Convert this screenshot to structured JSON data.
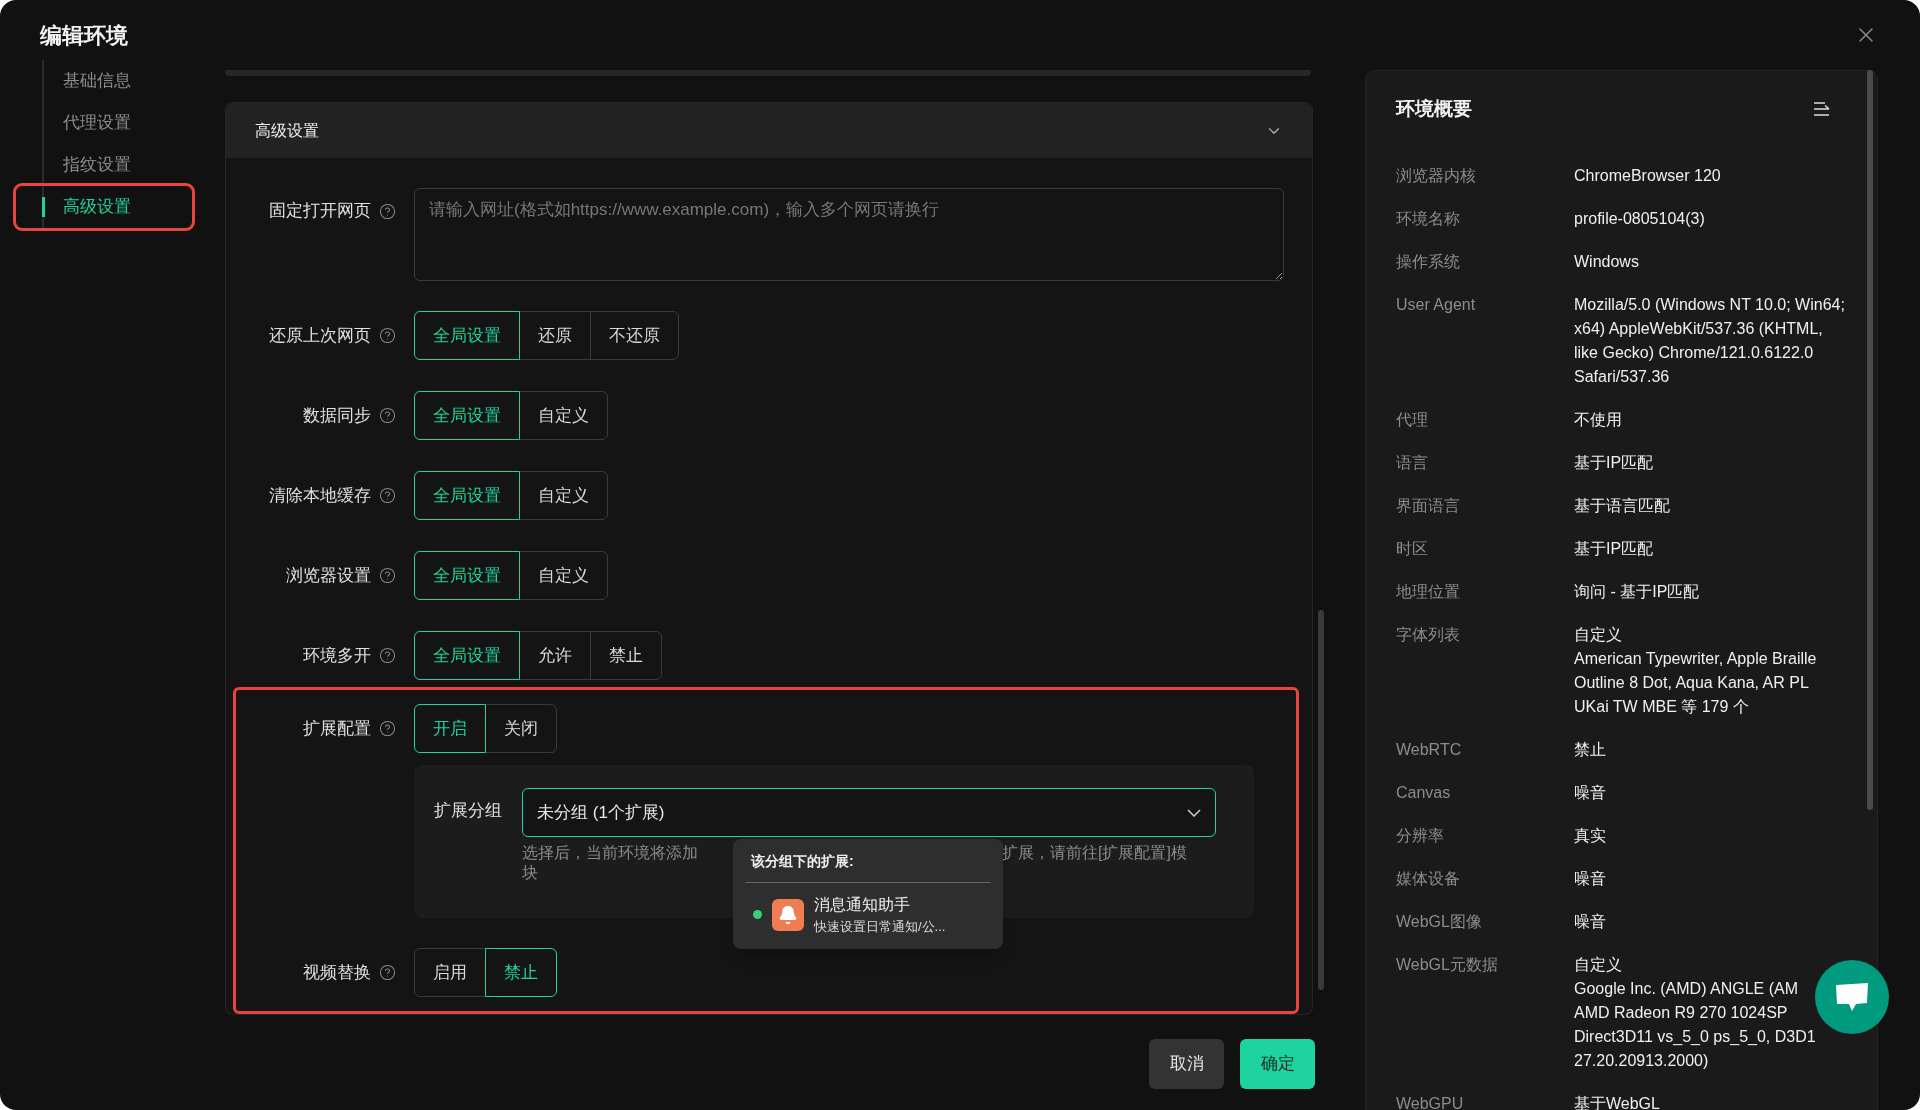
{
  "dialog": {
    "title": "编辑环境"
  },
  "nav": [
    {
      "label": "基础信息",
      "selected": false,
      "highlighted": false
    },
    {
      "label": "代理设置",
      "selected": false,
      "highlighted": false
    },
    {
      "label": "指纹设置",
      "selected": false,
      "highlighted": false
    },
    {
      "label": "高级设置",
      "selected": true,
      "highlighted": true
    }
  ],
  "section": {
    "title": "高级设置",
    "expanded": true
  },
  "url_field": {
    "label": "固定打开网页",
    "placeholder": "请输入网址(格式如https://www.example.com)，输入多个网页请换行"
  },
  "rows": [
    {
      "label": "还原上次网页",
      "options": [
        {
          "label": "全局设置",
          "selected": true
        },
        {
          "label": "还原",
          "selected": false
        },
        {
          "label": "不还原",
          "selected": false
        }
      ]
    },
    {
      "label": "数据同步",
      "options": [
        {
          "label": "全局设置",
          "selected": true
        },
        {
          "label": "自定义",
          "selected": false
        }
      ]
    },
    {
      "label": "清除本地缓存",
      "options": [
        {
          "label": "全局设置",
          "selected": true
        },
        {
          "label": "自定义",
          "selected": false
        }
      ]
    },
    {
      "label": "浏览器设置",
      "options": [
        {
          "label": "全局设置",
          "selected": true
        },
        {
          "label": "自定义",
          "selected": false
        }
      ]
    },
    {
      "label": "环境多开",
      "options": [
        {
          "label": "全局设置",
          "selected": true
        },
        {
          "label": "允许",
          "selected": false
        },
        {
          "label": "禁止",
          "selected": false
        }
      ]
    }
  ],
  "extension_block": {
    "highlighted": true,
    "extension": {
      "label": "扩展配置",
      "options": [
        {
          "label": "开启",
          "selected": true
        },
        {
          "label": "关闭",
          "selected": false
        }
      ]
    },
    "group": {
      "label": "扩展分组",
      "value": "未分组 (1个扩展)",
      "hint_parts": [
        "选择后，当前环境将添加",
        "扩展，请前往[扩展配置]模",
        "块"
      ]
    },
    "popover": {
      "title": "该分组下的扩展:",
      "items": [
        {
          "name": "消息通知助手",
          "description": "快速设置日常通知/公...",
          "enabled": true
        }
      ]
    },
    "video": {
      "label": "视频替换",
      "options": [
        {
          "label": "启用",
          "selected": false
        },
        {
          "label": "禁止",
          "selected": true
        }
      ]
    }
  },
  "buttons": [
    {
      "label": "取消",
      "kind": "secondary"
    },
    {
      "label": "确定",
      "kind": "primary"
    }
  ],
  "summary": {
    "title": "环境概要",
    "rows": [
      {
        "label": "浏览器内核",
        "value": [
          "ChromeBrowser 120"
        ]
      },
      {
        "label": "环境名称",
        "value": [
          "profile-0805104(3)"
        ]
      },
      {
        "label": "操作系统",
        "value": [
          "Windows"
        ]
      },
      {
        "label": "User Agent",
        "value": [
          "Mozilla/5.0 (Windows NT 10.0; Win64; x64) AppleWebKit/537.36 (KHTML, like Gecko) Chrome/121.0.6122.0 Safari/537.36"
        ]
      },
      {
        "label": "代理",
        "value": [
          "不使用"
        ]
      },
      {
        "label": "语言",
        "value": [
          "基于IP匹配"
        ]
      },
      {
        "label": "界面语言",
        "value": [
          "基于语言匹配"
        ]
      },
      {
        "label": "时区",
        "value": [
          "基于IP匹配"
        ]
      },
      {
        "label": "地理位置",
        "value": [
          "询问 - 基于IP匹配"
        ]
      },
      {
        "label": "字体列表",
        "value": [
          "自定义",
          "American Typewriter, Apple Braille Outline 8 Dot, Aqua Kana, AR PL UKai TW MBE 等 179 个"
        ]
      },
      {
        "label": "WebRTC",
        "value": [
          "禁止"
        ]
      },
      {
        "label": "Canvas",
        "value": [
          "噪音"
        ]
      },
      {
        "label": "分辨率",
        "value": [
          "真实"
        ]
      },
      {
        "label": "媒体设备",
        "value": [
          "噪音"
        ]
      },
      {
        "label": "WebGL图像",
        "value": [
          "噪音"
        ]
      },
      {
        "label": "WebGL元数据",
        "value": [
          "自定义",
          "Google Inc. (AMD) ANGLE (AM",
          "AMD Radeon R9 270 1024SP",
          "Direct3D11 vs_5_0 ps_5_0, D3D1",
          "27.20.20913.2000)"
        ]
      },
      {
        "label": "WebGPU",
        "value": [
          "基于WebGL"
        ]
      }
    ]
  }
}
